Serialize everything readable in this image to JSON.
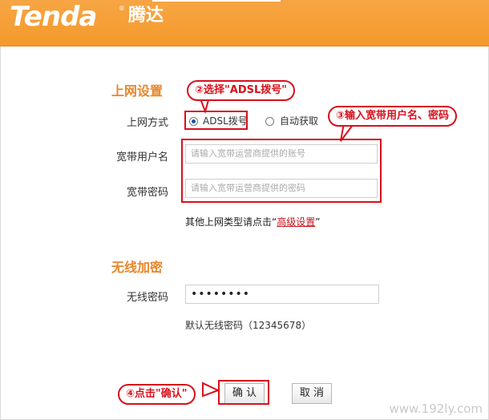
{
  "brand": {
    "logo": "Tenda",
    "reg": "®",
    "cn": "腾达"
  },
  "internet": {
    "title": "上网设置",
    "mode_label": "上网方式",
    "options": [
      {
        "label": "ADSL拨号",
        "checked": true
      },
      {
        "label": "自动获取",
        "checked": false
      }
    ],
    "username_label": "宽带用户名",
    "username_placeholder": "请输入宽带运营商提供的账号",
    "password_label": "宽带密码",
    "password_placeholder": "请输入宽带运营商提供的密码",
    "other_hint_prefix": "其他上网类型请点击“",
    "advanced_link": "高级设置",
    "other_hint_suffix": "”"
  },
  "wireless": {
    "title": "无线加密",
    "password_label": "无线密码",
    "password_value": "••••••••",
    "default_hint": "默认无线密码（12345678）"
  },
  "buttons": {
    "ok": "确 认",
    "cancel": "取 消"
  },
  "callouts": {
    "step2": "②选择\"ADSL拨号\"",
    "step3": "③输入宽带用户名、密码",
    "step4": "④点击\"确认\""
  },
  "watermark": "www.192ly.com",
  "colors": {
    "header": "#f39a2b",
    "section_title": "#e9862a",
    "annotation_red": "#d8101c"
  }
}
